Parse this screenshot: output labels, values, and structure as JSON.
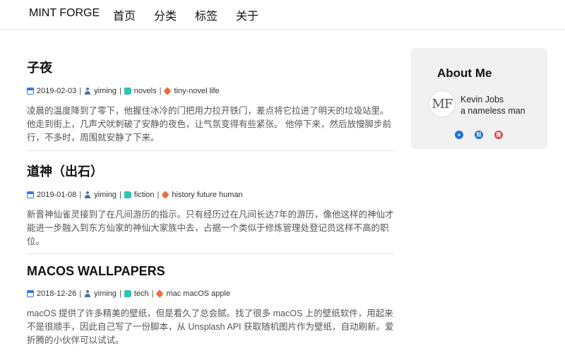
{
  "nav": {
    "brand": "MINT FORGE",
    "links": [
      "首页",
      "分类",
      "标签",
      "关于"
    ]
  },
  "posts": [
    {
      "title": "子夜",
      "date": "2019-02-03",
      "author": "yiming",
      "category": "novels",
      "tags": "tiny-novel life",
      "excerpt": "凌晨的温度降到了零下，他握住冰冷的门把用力拉开铁门，差点将它拉进了明天的垃圾站里。 他走到街上，几声犬吠刺破了安静的夜色，让气氛变得有些紧张。 他停下来，然后放慢脚步前行，不多时，周围就安静了下来。"
    },
    {
      "title": "道神（出石）",
      "date": "2019-01-08",
      "author": "yiming",
      "category": "fiction",
      "tags": "history future human",
      "excerpt": "新晋神仙雀灵接到了在凡间游历的指示。只有经历过在凡间长达7年的游历，像他这样的神仙才能进一步融入到东方仙家的神仙大家族中去，占据一个类似于修炼管理处登记员这样不高的职位。"
    },
    {
      "title": "MACOS WALLPAPERS",
      "date": "2018-12-26",
      "author": "yiming",
      "category": "tech",
      "tags": "mac macOS apple",
      "excerpt": "macOS 提供了许多精美的壁纸，但是看久了总会腻。找了很多 macOS 上的壁纸软件，用起来不是很顺手，因此自己写了一份脚本，从 Unsplash API 获取随机图片作为壁纸，自动刷新。爱折腾的小伙伴可以试试。"
    }
  ],
  "about": {
    "title": "About Me",
    "avatar_text": "MF",
    "name": "Kevin Jobs",
    "bio": "a nameless man",
    "social_icons": [
      "github-icon",
      "zhihu-icon",
      "weibo-icon"
    ],
    "social_glyphs": [
      "●",
      "知",
      "微"
    ]
  },
  "meta_separator": "|"
}
